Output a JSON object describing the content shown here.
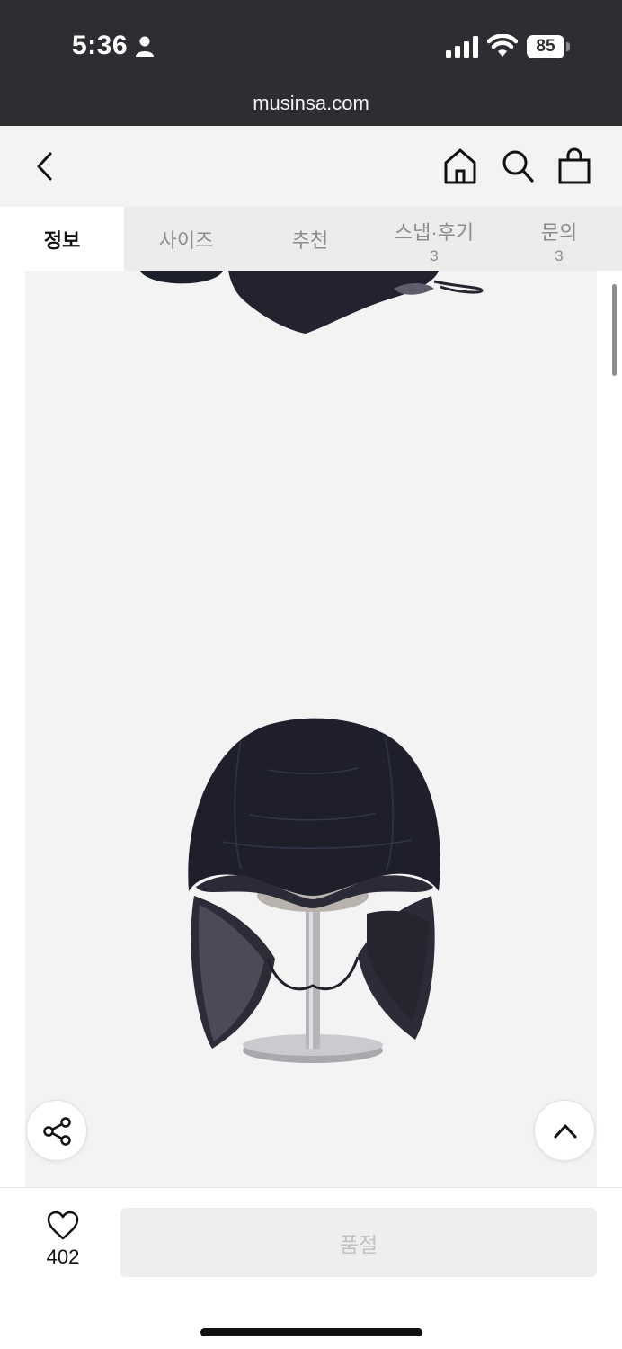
{
  "status_bar": {
    "time": "5:36",
    "battery": "85",
    "icons": [
      "person-icon",
      "signal-icon",
      "wifi-icon",
      "battery-icon"
    ]
  },
  "browser": {
    "url": "musinsa.com"
  },
  "header": {
    "icons": [
      "back-icon",
      "home-icon",
      "search-icon",
      "bag-icon"
    ]
  },
  "tabs": [
    {
      "label": "정보",
      "count": ""
    },
    {
      "label": "사이즈",
      "count": ""
    },
    {
      "label": "추천",
      "count": ""
    },
    {
      "label": "스냅·후기",
      "count": "3"
    },
    {
      "label": "문의",
      "count": "3"
    }
  ],
  "floating": {
    "share_icon": "share-icon",
    "top_icon": "chevron-up-icon"
  },
  "bottom_bar": {
    "like_icon": "heart-icon",
    "like_count": "402",
    "purchase_label": "품절"
  },
  "colors": {
    "status_bar_bg": "#2c2e31",
    "header_bg": "#f3f3f3",
    "tab_bar_bg": "#ececec",
    "image_bg": "#f3f3f3",
    "soldout_bg": "#eeeeee",
    "soldout_text": "#c2c2c2"
  }
}
